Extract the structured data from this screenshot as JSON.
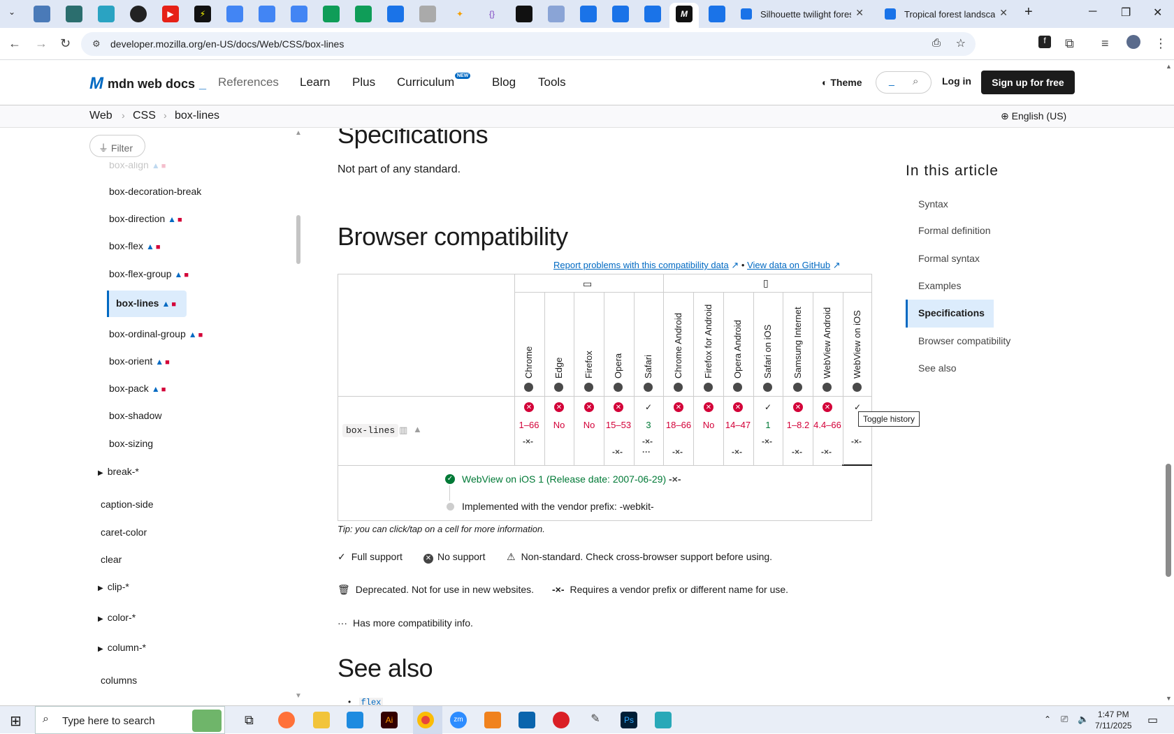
{
  "browser": {
    "tabs": [
      {
        "label": "Silhouette twilight forest"
      },
      {
        "label": "Tropical forest landscape"
      }
    ],
    "tab_close": "✕",
    "new_tab": "+",
    "url": "developer.mozilla.org/en-US/docs/Web/CSS/box-lines"
  },
  "mdn": {
    "logo_text": "mdn web docs",
    "nav": [
      "References",
      "Learn",
      "Plus",
      "Curriculum",
      "Blog",
      "Tools"
    ],
    "new_badge": "NEW",
    "theme": "Theme",
    "login": "Log in",
    "signup": "Sign up for free",
    "breadcrumbs": [
      "Web",
      "CSS",
      "box-lines"
    ],
    "language": "English (US)"
  },
  "sidebar": {
    "filter": "Filter",
    "items": [
      {
        "label": "box-align"
      },
      {
        "label": "box-decoration-break"
      },
      {
        "label": "box-direction"
      },
      {
        "label": "box-flex"
      },
      {
        "label": "box-flex-group"
      },
      {
        "label": "box-lines"
      },
      {
        "label": "box-ordinal-group"
      },
      {
        "label": "box-orient"
      },
      {
        "label": "box-pack"
      },
      {
        "label": "box-shadow"
      },
      {
        "label": "box-sizing"
      },
      {
        "label": "break-*"
      },
      {
        "label": "caption-side"
      },
      {
        "label": "caret-color"
      },
      {
        "label": "clear"
      },
      {
        "label": "clip-*"
      },
      {
        "label": "color-*"
      },
      {
        "label": "column-*"
      },
      {
        "label": "columns"
      }
    ]
  },
  "main": {
    "specifications_heading": "Specifications",
    "specifications_text": "Not part of any standard.",
    "compat_heading": "Browser compatibility",
    "report_link": "Report problems with this compatibility data",
    "github_link": "View data on GitHub",
    "link_separator": "•",
    "feature": "box-lines",
    "browsers": [
      "Chrome",
      "Edge",
      "Firefox",
      "Opera",
      "Safari",
      "Chrome Android",
      "Firefox for Android",
      "Opera Android",
      "Safari on iOS",
      "Samsung Internet",
      "WebView Android",
      "WebView on iOS"
    ],
    "support": [
      "1–66",
      "No",
      "No",
      "15–53",
      "3",
      "18–66",
      "No",
      "14–47",
      "1",
      "1–8.2",
      "4.4–66",
      ""
    ],
    "tooltip": "Toggle history",
    "history_release": "WebView on iOS 1 (Release date: 2007-06-29)",
    "history_note": "Implemented with the vendor prefix: -webkit-",
    "tip": "Tip: you can click/tap on a cell for more information.",
    "legend": {
      "full": "Full support",
      "none": "No support",
      "nonstandard": "Non-standard. Check cross-browser support before using.",
      "deprecated": "Deprecated. Not for use in new websites.",
      "prefix": "Requires a vendor prefix or different name for use.",
      "more": "Has more compatibility info."
    },
    "see_also_heading": "See also",
    "see_also_first": "flex"
  },
  "toc": {
    "title": "In this article",
    "items": [
      "Syntax",
      "Formal definition",
      "Formal syntax",
      "Examples",
      "Specifications",
      "Browser compatibility",
      "See also"
    ]
  },
  "taskbar": {
    "search_placeholder": "Type here to search",
    "time": "1:47 PM",
    "date": "7/11/2025"
  }
}
